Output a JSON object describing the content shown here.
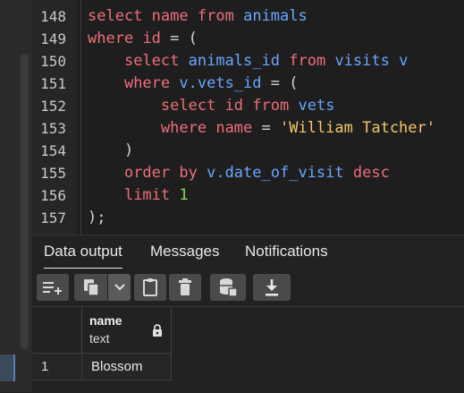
{
  "editor": {
    "line_numbers": [
      "148",
      "149",
      "150",
      "151",
      "152",
      "153",
      "154",
      "155",
      "156",
      "157"
    ],
    "lines": [
      [
        {
          "t": "select",
          "c": "kw"
        },
        {
          "t": " ",
          "c": "op"
        },
        {
          "t": "name",
          "c": "kw"
        },
        {
          "t": " ",
          "c": "op"
        },
        {
          "t": "from",
          "c": "kw"
        },
        {
          "t": " ",
          "c": "op"
        },
        {
          "t": "animals",
          "c": "id"
        }
      ],
      [
        {
          "t": "where",
          "c": "kw"
        },
        {
          "t": " ",
          "c": "op"
        },
        {
          "t": "id",
          "c": "kw"
        },
        {
          "t": " = (",
          "c": "op"
        }
      ],
      [
        {
          "t": "    ",
          "c": "op"
        },
        {
          "t": "select",
          "c": "kw"
        },
        {
          "t": " ",
          "c": "op"
        },
        {
          "t": "animals_id",
          "c": "id"
        },
        {
          "t": " ",
          "c": "op"
        },
        {
          "t": "from",
          "c": "kw"
        },
        {
          "t": " ",
          "c": "op"
        },
        {
          "t": "visits",
          "c": "id"
        },
        {
          "t": " ",
          "c": "op"
        },
        {
          "t": "v",
          "c": "id"
        }
      ],
      [
        {
          "t": "    ",
          "c": "op"
        },
        {
          "t": "where",
          "c": "kw"
        },
        {
          "t": " ",
          "c": "op"
        },
        {
          "t": "v.vets_id",
          "c": "id"
        },
        {
          "t": " = (",
          "c": "op"
        }
      ],
      [
        {
          "t": "        ",
          "c": "op"
        },
        {
          "t": "select",
          "c": "kw"
        },
        {
          "t": " ",
          "c": "op"
        },
        {
          "t": "id",
          "c": "kw"
        },
        {
          "t": " ",
          "c": "op"
        },
        {
          "t": "from",
          "c": "kw"
        },
        {
          "t": " ",
          "c": "op"
        },
        {
          "t": "vets",
          "c": "id"
        }
      ],
      [
        {
          "t": "        ",
          "c": "op"
        },
        {
          "t": "where",
          "c": "kw"
        },
        {
          "t": " ",
          "c": "op"
        },
        {
          "t": "name",
          "c": "kw"
        },
        {
          "t": " = ",
          "c": "op"
        },
        {
          "t": "'William Tatcher'",
          "c": "str"
        }
      ],
      [
        {
          "t": "    )",
          "c": "op"
        }
      ],
      [
        {
          "t": "    ",
          "c": "op"
        },
        {
          "t": "order by",
          "c": "kw"
        },
        {
          "t": " ",
          "c": "op"
        },
        {
          "t": "v.date_of_visit",
          "c": "id"
        },
        {
          "t": " ",
          "c": "op"
        },
        {
          "t": "desc",
          "c": "kw"
        }
      ],
      [
        {
          "t": "    ",
          "c": "op"
        },
        {
          "t": "limit",
          "c": "kw"
        },
        {
          "t": " ",
          "c": "op"
        },
        {
          "t": "1",
          "c": "num"
        }
      ],
      [
        {
          "t": ");",
          "c": "op"
        }
      ]
    ]
  },
  "tabs": {
    "data_output": "Data output",
    "messages": "Messages",
    "notifications": "Notifications"
  },
  "toolbar": {
    "icons": [
      "add-row-icon",
      "copy-icon",
      "chevron-down-icon",
      "paste-icon",
      "delete-icon",
      "save-data-icon",
      "download-icon"
    ]
  },
  "result": {
    "column": {
      "name": "name",
      "type": "text"
    },
    "rows": [
      {
        "num": "1",
        "value": "Blossom"
      }
    ]
  }
}
